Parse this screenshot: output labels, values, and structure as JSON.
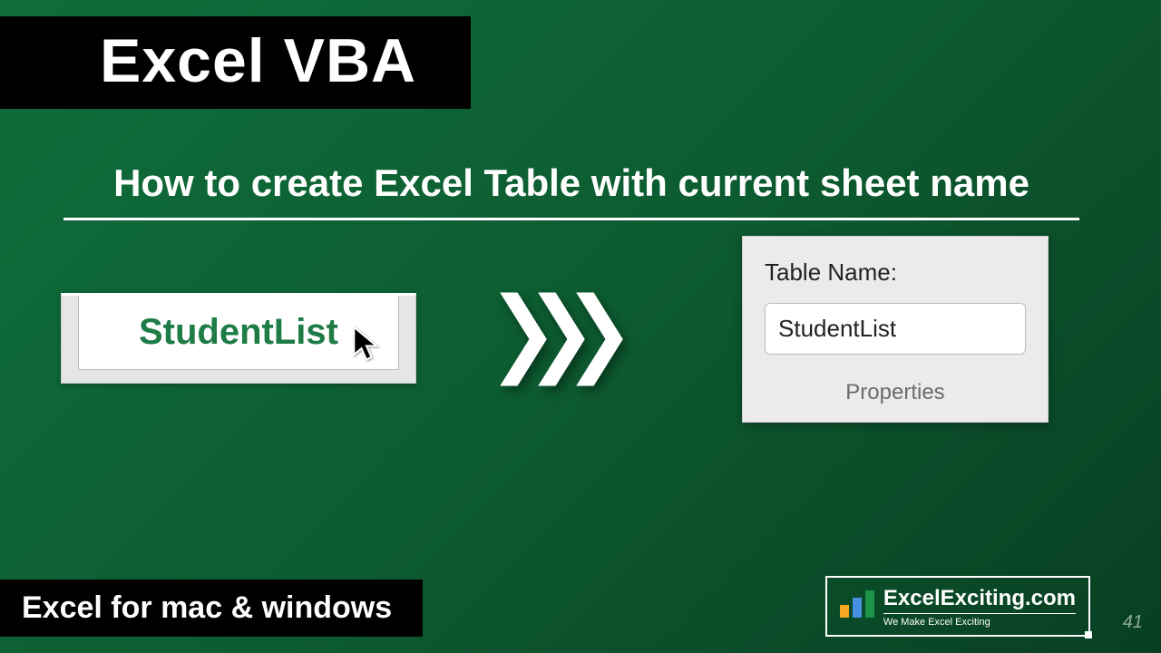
{
  "title": "Excel VBA",
  "subtitle": "How to create Excel Table with current sheet name",
  "sheet_tab": {
    "name": "StudentList"
  },
  "panel": {
    "label": "Table Name:",
    "value": "StudentList",
    "footer": "Properties"
  },
  "bottom_text": "Excel for mac & windows",
  "logo": {
    "main": "ExcelExciting.com",
    "sub": "We Make Excel Exciting"
  },
  "page_number": "41"
}
